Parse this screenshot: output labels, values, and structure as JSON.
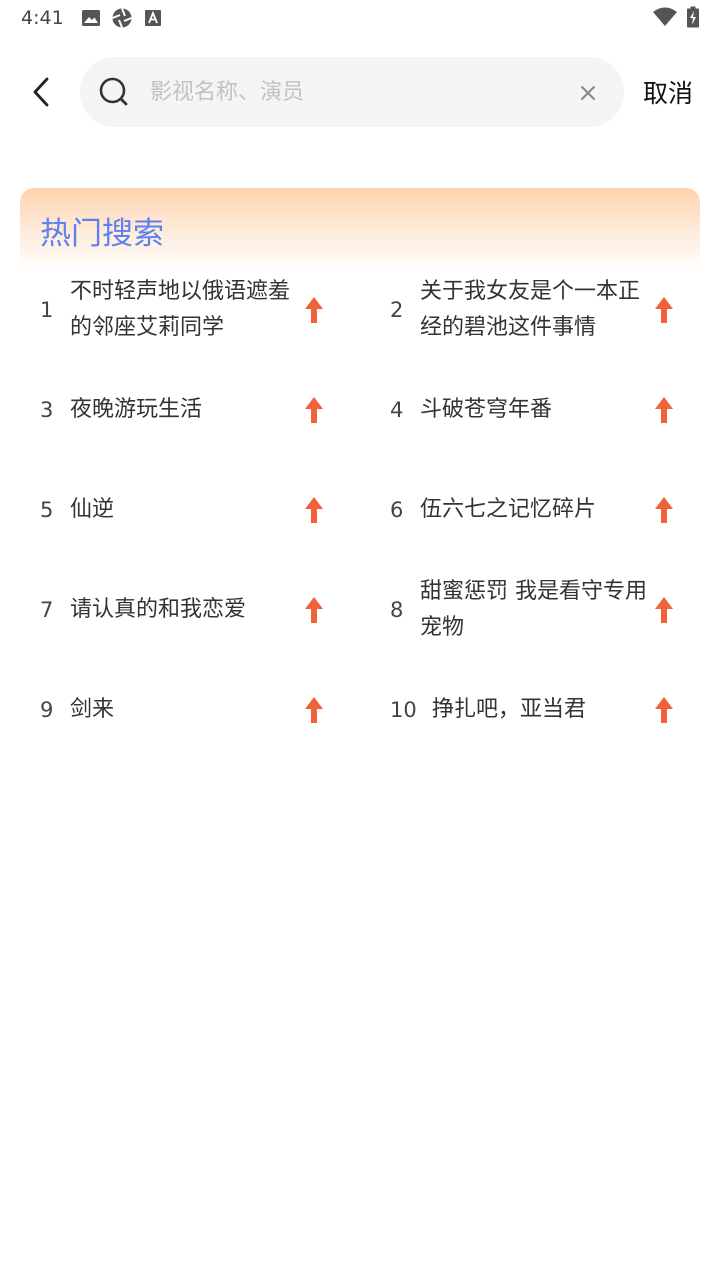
{
  "status_bar": {
    "time": "4:41",
    "icons_left": [
      "image-icon",
      "aperture-icon",
      "font-a-icon"
    ],
    "icons_right": [
      "wifi-icon",
      "battery-charging-icon"
    ]
  },
  "search": {
    "placeholder": "影视名称、演员",
    "value": "",
    "cancel_label": "取消"
  },
  "hot_search": {
    "title": "热门搜索",
    "accent_color": "#5f80f0",
    "trend_color": "#f0623a",
    "items": [
      {
        "rank": "1",
        "text": "不时轻声地以俄语遮羞的邻座艾莉同学"
      },
      {
        "rank": "2",
        "text": "关于我女友是个一本正经的碧池这件事情"
      },
      {
        "rank": "3",
        "text": "夜晚游玩生活"
      },
      {
        "rank": "4",
        "text": "斗破苍穹年番"
      },
      {
        "rank": "5",
        "text": "仙逆"
      },
      {
        "rank": "6",
        "text": "伍六七之记忆碎片"
      },
      {
        "rank": "7",
        "text": "请认真的和我恋爱"
      },
      {
        "rank": "8",
        "text": "甜蜜惩罚 我是看守专用宠物"
      },
      {
        "rank": "9",
        "text": "剑来"
      },
      {
        "rank": "10",
        "text": "挣扎吧，亚当君"
      }
    ]
  }
}
